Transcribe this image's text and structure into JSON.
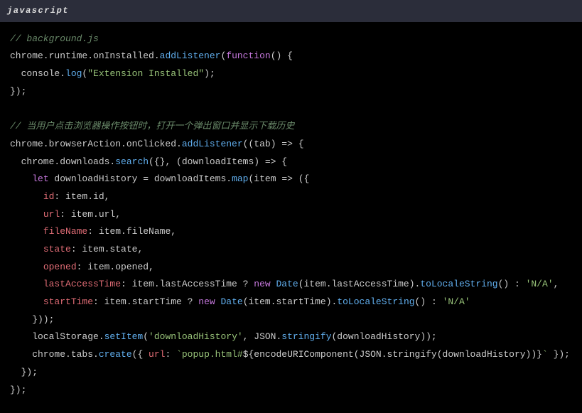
{
  "header": {
    "language": "javascript"
  },
  "code": {
    "c01": "// background.js",
    "l02_a": "chrome.runtime.onInstalled.",
    "l02_b": "addListener",
    "l02_c": "(",
    "l02_d": "function",
    "l02_e": "() {",
    "l03_a": "  console.",
    "l03_b": "log",
    "l03_c": "(",
    "l03_d": "\"Extension Installed\"",
    "l03_e": ");",
    "l04": "});",
    "c05": "// 当用户点击浏览器操作按钮时，打开一个弹出窗口并显示下载历史",
    "l06_a": "chrome.browserAction.onClicked.",
    "l06_b": "addListener",
    "l06_c": "((",
    "l06_d": "tab",
    "l06_e": ") => {",
    "l07_a": "  chrome.downloads.",
    "l07_b": "search",
    "l07_c": "({}, (",
    "l07_d": "downloadItems",
    "l07_e": ") => {",
    "l08_a": "    ",
    "l08_b": "let",
    "l08_c": " downloadHistory = downloadItems.",
    "l08_d": "map",
    "l08_e": "(",
    "l08_f": "item",
    "l08_g": " => ({",
    "l09_a": "      ",
    "l09_b": "id",
    "l09_c": ": item.id,",
    "l10_a": "      ",
    "l10_b": "url",
    "l10_c": ": item.url,",
    "l11_a": "      ",
    "l11_b": "fileName",
    "l11_c": ": item.fileName,",
    "l12_a": "      ",
    "l12_b": "state",
    "l12_c": ": item.state,",
    "l13_a": "      ",
    "l13_b": "opened",
    "l13_c": ": item.opened,",
    "l14_a": "      ",
    "l14_b": "lastAccessTime",
    "l14_c": ": item.lastAccessTime ? ",
    "l14_d": "new",
    "l14_e": " ",
    "l14_f": "Date",
    "l14_g": "(item.lastAccessTime).",
    "l14_h": "toLocaleString",
    "l14_i": "() : ",
    "l14_j": "'N/A'",
    "l14_k": ",",
    "l15_a": "      ",
    "l15_b": "startTime",
    "l15_c": ": item.startTime ? ",
    "l15_d": "new",
    "l15_e": " ",
    "l15_f": "Date",
    "l15_g": "(item.startTime).",
    "l15_h": "toLocaleString",
    "l15_i": "() : ",
    "l15_j": "'N/A'",
    "l16": "    }));",
    "l17_a": "    localStorage.",
    "l17_b": "setItem",
    "l17_c": "(",
    "l17_d": "'downloadHistory'",
    "l17_e": ", JSON.",
    "l17_f": "stringify",
    "l17_g": "(downloadHistory));",
    "l18_a": "    chrome.tabs.",
    "l18_b": "create",
    "l18_c": "({ ",
    "l18_d": "url",
    "l18_e": ": ",
    "l18_f": "`popup.html#",
    "l18_g": "${encodeURIComponent(JSON.stringify(downloadHistory))}",
    "l18_h": "`",
    "l18_i": " });",
    "l19": "  });",
    "l20": "});"
  }
}
